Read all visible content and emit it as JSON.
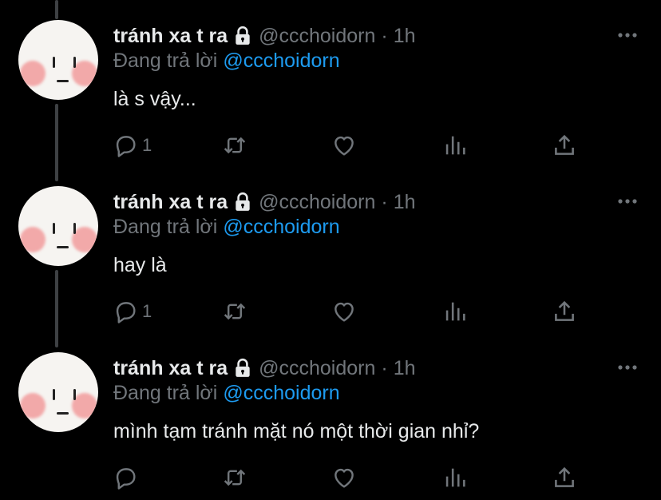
{
  "colors": {
    "background": "#000000",
    "text_primary": "#e7e9ea",
    "text_secondary": "#71767b",
    "mention": "#1d9bf0",
    "thread_line": "#3e4144"
  },
  "tweets": [
    {
      "display_name": "tránh xa t ra",
      "handle": "@ccchoidorn",
      "separator": "·",
      "time": "1h",
      "reply_prefix": "Đang trả lời",
      "reply_to": "@ccchoidorn",
      "text": "là s vậy...",
      "reply_count": "1",
      "icons": [
        "lock-icon",
        "more-icon",
        "reply-icon",
        "retweet-icon",
        "like-icon",
        "views-icon",
        "share-icon"
      ]
    },
    {
      "display_name": "tránh xa t ra",
      "handle": "@ccchoidorn",
      "separator": "·",
      "time": "1h",
      "reply_prefix": "Đang trả lời",
      "reply_to": "@ccchoidorn",
      "text": "hay là",
      "reply_count": "1",
      "icons": [
        "lock-icon",
        "more-icon",
        "reply-icon",
        "retweet-icon",
        "like-icon",
        "views-icon",
        "share-icon"
      ]
    },
    {
      "display_name": "tránh xa t ra",
      "handle": "@ccchoidorn",
      "separator": "·",
      "time": "1h",
      "reply_prefix": "Đang trả lời",
      "reply_to": "@ccchoidorn",
      "text": "mình tạm tránh mặt nó một thời gian nhỉ?",
      "reply_count": "",
      "icons": [
        "lock-icon",
        "more-icon",
        "reply-icon",
        "retweet-icon",
        "like-icon",
        "views-icon",
        "share-icon"
      ]
    }
  ]
}
